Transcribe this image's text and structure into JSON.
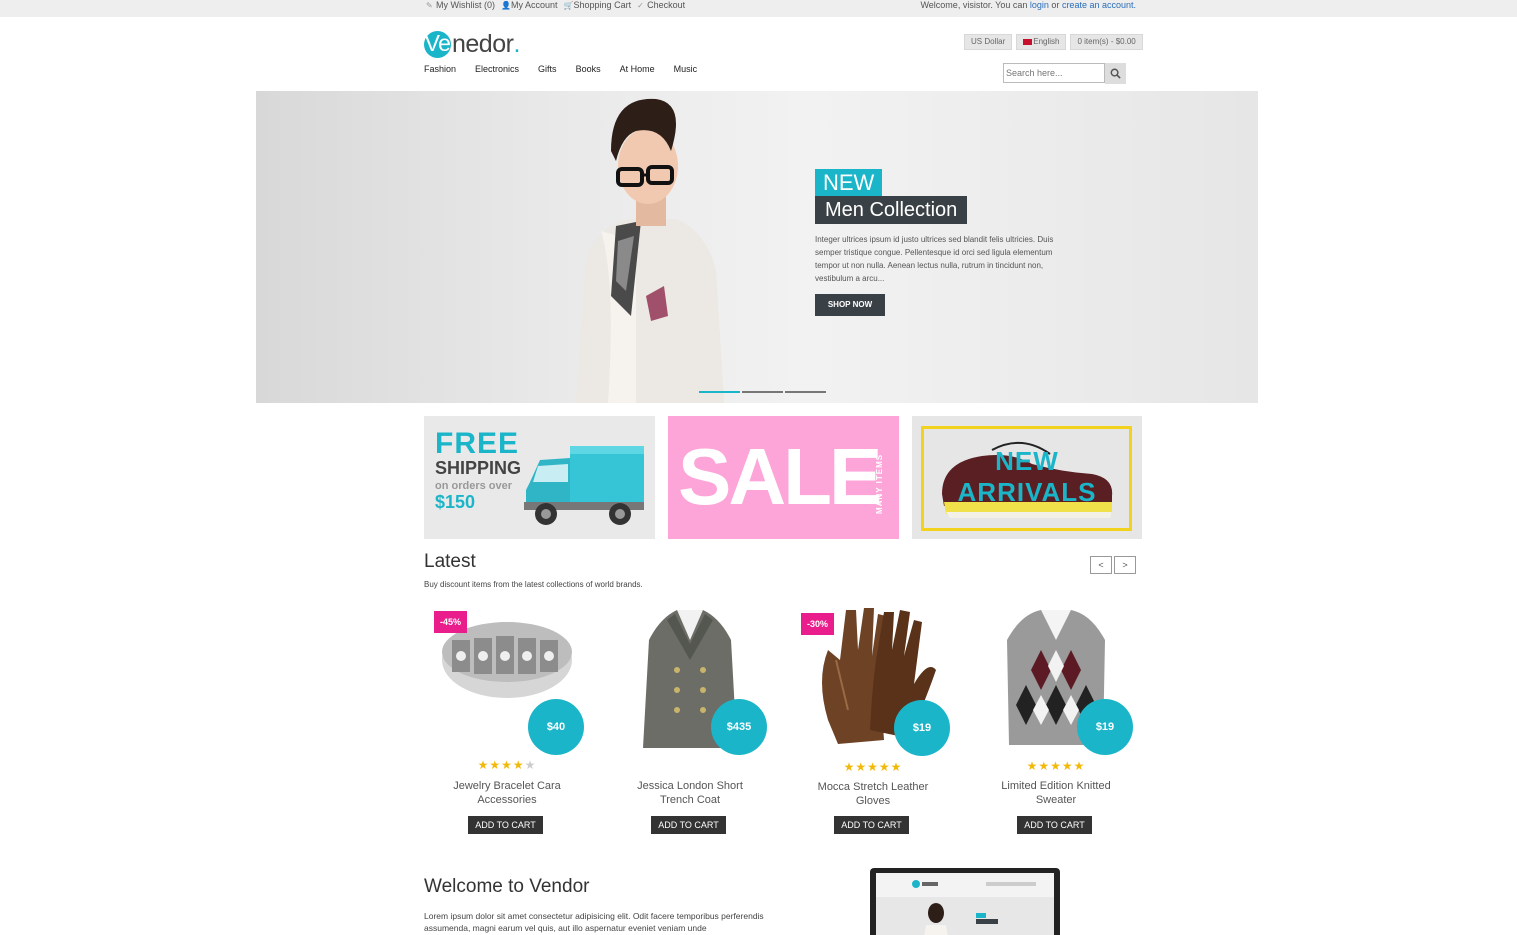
{
  "topbar": {
    "wishlist": "My Wishlist (0)",
    "account": "My Account",
    "cart": "Shopping Cart",
    "checkout": "Checkout",
    "welcome_prefix": "Welcome, visistor. You can",
    "login": "login",
    "or": "or",
    "create": "create an account."
  },
  "header": {
    "logo_letter": "Ve",
    "logo_rest": "nedor",
    "logo_dot": ".",
    "currency": "US Dollar",
    "language": "English",
    "cart_summary": "0 item(s) - $0.00",
    "search_placeholder": "Search here..."
  },
  "nav": [
    "Fashion",
    "Electronics",
    "Gifts",
    "Books",
    "At Home",
    "Music"
  ],
  "hero": {
    "tag": "NEW",
    "title": "Men Collection",
    "description": "Integer ultrices ipsum id justo ultrices sed blandit felis ultricies. Duis semper tristique congue. Pellentesque id orci sed ligula elementum tempor ut non nulla. Aenean lectus nulla, rutrum in tincidunt non, vestibulum a arcu...",
    "button": "SHOP NOW",
    "slides": 3,
    "active_slide": 1
  },
  "promos": {
    "free": "FREE",
    "shipping": "SHIPPING",
    "orders": "on orders over",
    "amount": "$150",
    "sale": "SALE",
    "many": "MANY ITEMS",
    "new1": "NEW",
    "new2": "ARRIVALS"
  },
  "latest": {
    "title": "Latest",
    "subtitle": "Buy discount items from the latest collections of world brands.",
    "prev": "<",
    "next": ">",
    "products": [
      {
        "name1": "Jewelry Bracelet Cara",
        "name2": "Accessories",
        "price": "$40",
        "badge": "-45%",
        "rating": 4,
        "cart": "ADD TO CART"
      },
      {
        "name1": "Jessica London Short",
        "name2": "Trench Coat",
        "price": "$435",
        "badge": "",
        "rating": 0,
        "cart": "ADD TO CART"
      },
      {
        "name1": "Mocca Stretch Leather",
        "name2": "Gloves",
        "price": "$19",
        "badge": "-30%",
        "rating": 5,
        "cart": "ADD TO CART"
      },
      {
        "name1": "Limited Edition Knitted",
        "name2": "Sweater",
        "price": "$19",
        "badge": "",
        "rating": 5,
        "cart": "ADD TO CART"
      }
    ]
  },
  "welcome": {
    "title": "Welcome to Vendor",
    "text": "Lorem ipsum dolor sit amet consectetur adipisicing elit. Odit facere temporibus perferendis assumenda, magni earum vel quis, aut illo aspernatur eveniet veniam unde"
  },
  "colors": {
    "accent": "#1bb5c9",
    "badge": "#e91e8c",
    "dark": "#3a4146",
    "sale_pink": "#fda4d8",
    "star": "#f3b90a"
  }
}
